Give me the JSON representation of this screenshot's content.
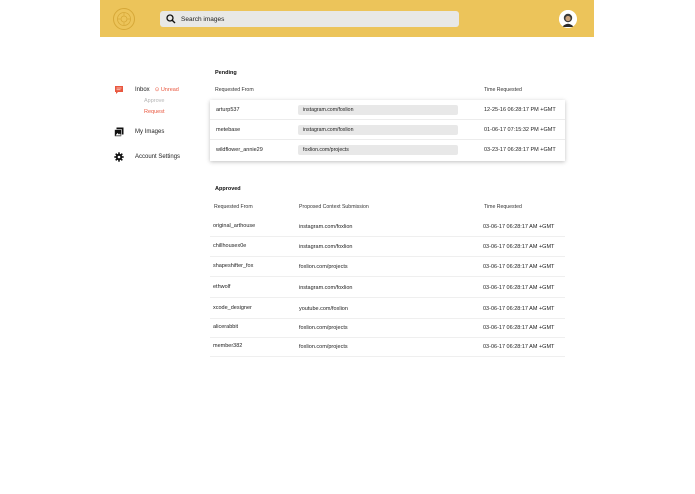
{
  "colors": {
    "topbar": "#ecc45a",
    "accent": "#e9573f",
    "muted": "#b5b5b5"
  },
  "header": {
    "search_placeholder": "Search images",
    "logo_icon": "emblem-icon",
    "avatar_icon": "user-avatar"
  },
  "sidebar": {
    "inbox_label": "Inbox",
    "unread_label": "Unread",
    "approve_label": "Approve",
    "request_label": "Request",
    "my_images_label": "My Images",
    "account_settings_label": "Account Settings"
  },
  "pending": {
    "title": "Pending",
    "col_requested_from": "Requested From",
    "col_time_requested": "Time Requested",
    "rows": [
      {
        "from": "arturp537",
        "link": "instagram.com/foxlion",
        "time": "12-25-16 06:28:17 PM +GMT"
      },
      {
        "from": "metebase",
        "link": "instagram.com/foxlion",
        "time": "01-06-17 07:15:32 PM +GMT"
      },
      {
        "from": "wildflower_annie29",
        "link": "foxlion.com/projects",
        "time": "03-23-17 06:28:17 PM +GMT"
      }
    ]
  },
  "approved": {
    "title": "Approved",
    "col_requested_from": "Requested From",
    "col_submission": "Proposed Context Submission",
    "col_time_requested": "Time Requested",
    "rows": [
      {
        "from": "original_arthouse",
        "link": "instagram.com/foxlion",
        "time": "03-06-17 06:28:17 AM +GMT"
      },
      {
        "from": "chillhousex0e",
        "link": "instagram.com/foxlion",
        "time": "03-06-17 06:28:17 AM +GMT"
      },
      {
        "from": "shapeshifter_fox",
        "link": "foxlion.com/projects",
        "time": "03-06-17 06:28:17 AM +GMT"
      },
      {
        "from": "ethwolf",
        "link": "instagram.com/foxlion",
        "time": "03-06-17 06:28:17 AM +GMT"
      },
      {
        "from": "xcode_designer",
        "link": "youtube.com/foxlion",
        "time": "03-06-17 06:28:17 AM +GMT"
      },
      {
        "from": "alicerabbit",
        "link": "foxlion.com/projects",
        "time": "03-06-17 06:28:17 AM +GMT"
      },
      {
        "from": "member382",
        "link": "foxlion.com/projects",
        "time": "03-06-17 06:28:17 AM +GMT"
      }
    ]
  }
}
